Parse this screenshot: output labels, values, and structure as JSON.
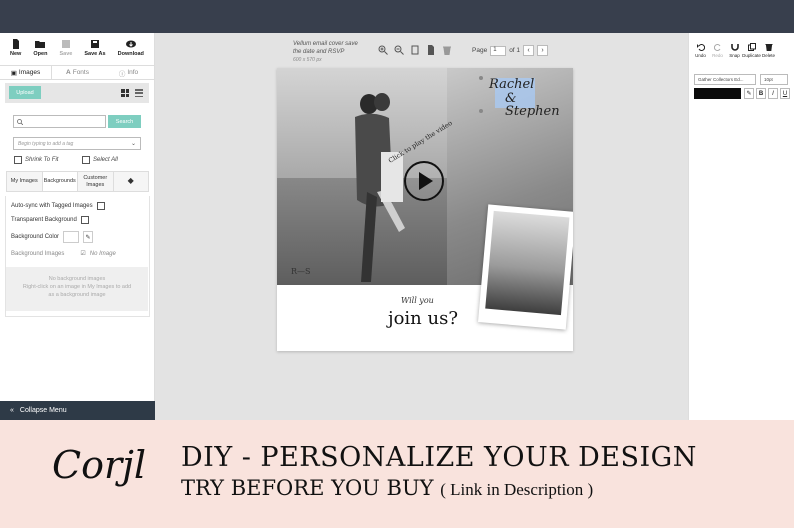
{
  "toolbar": {
    "new": "New",
    "open": "Open",
    "save": "Save",
    "save_as": "Save As",
    "download": "Download"
  },
  "left_tabs": [
    "Images",
    "Fonts",
    "Info"
  ],
  "upload_label": "Upload",
  "search": {
    "placeholder": "",
    "button": "Search"
  },
  "tag_placeholder": "Begin typing to add a tag",
  "checkboxes": {
    "shrink": "Shrink To Fit",
    "select_all": "Select All"
  },
  "image_tabs": [
    "My Images",
    "Backgrounds",
    "Customer Images"
  ],
  "bg_options": {
    "autosync": "Auto-sync with Tagged Images",
    "transparent": "Transparent Background",
    "bg_color": "Background Color",
    "bg_images": "Background Images",
    "no_image": "No Image"
  },
  "bg_empty": [
    "No background images",
    "Right-click on an image in My Images to add",
    "as a background image"
  ],
  "collapse": "Collapse Menu",
  "canvas": {
    "title_line1": "Vellum email cover save",
    "title_line2": "the date and RSVP",
    "dimensions": "600 x 570 px",
    "page_label": "Page",
    "page_value": "1",
    "page_of": "of 1"
  },
  "design": {
    "names": "Rachel & Stephen",
    "name1": "Rachel",
    "name2": "& Stephen",
    "play_text": "Click to play the video",
    "initials": "R—S",
    "will_you": "Will you",
    "join_us": "join us?"
  },
  "right_toolbar": {
    "undo": "Undo",
    "redo": "Redo",
    "snap": "Snap",
    "duplicate": "Duplicate",
    "delete": "Delete"
  },
  "font_name": "Gather Collectors Ed...",
  "font_size": "10pt",
  "format": {
    "bold": "B",
    "italic": "I",
    "underline": "U"
  },
  "banner": {
    "logo": "Corjl",
    "line1": "DIY - PERSONALIZE YOUR DESIGN",
    "line2": "TRY BEFORE YOU BUY",
    "line2_paren": "( Link in Description )"
  },
  "colors": {
    "topbar": "#383f4d",
    "accent": "#7ecec0",
    "banner": "#f9e3dd"
  }
}
